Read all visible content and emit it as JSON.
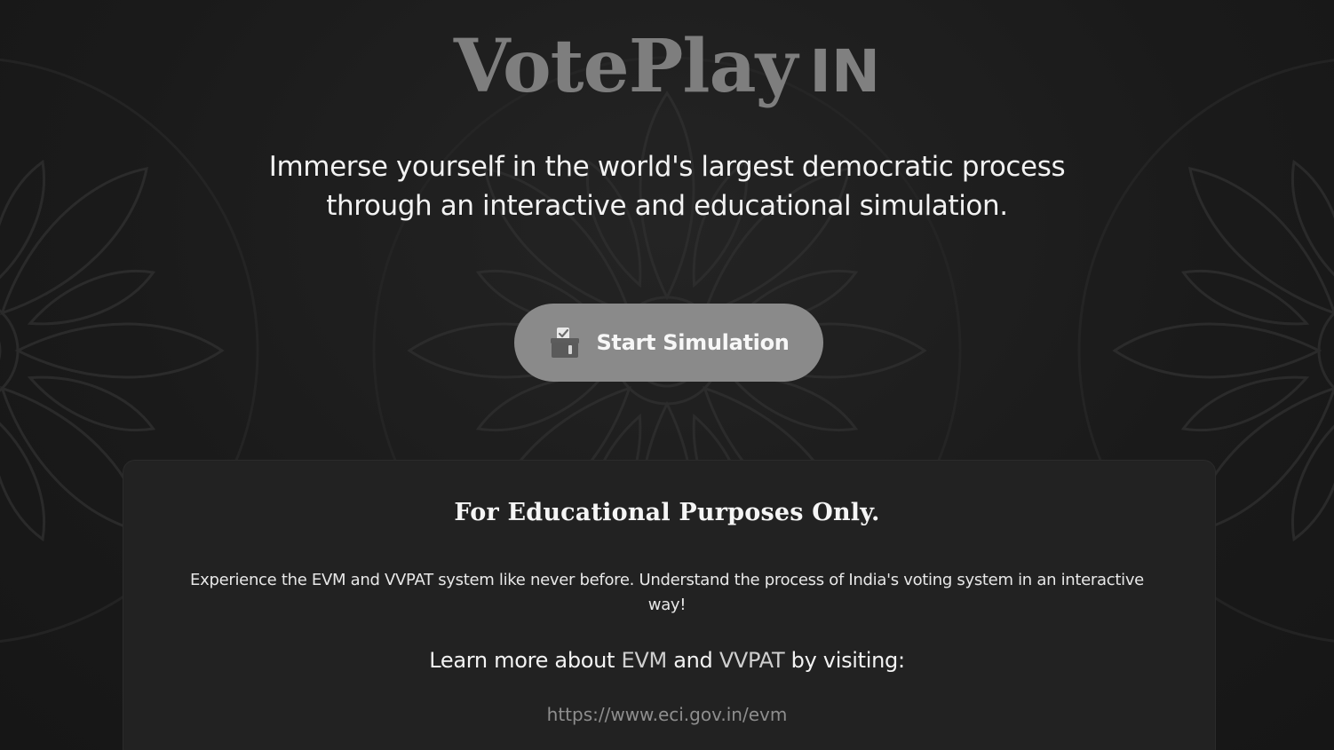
{
  "hero": {
    "brand_main": "VotePlay",
    "brand_suffix": "IN",
    "tagline_line1": "Immerse yourself in the world's largest democratic process",
    "tagline_line2": "through an interactive and educational simulation.",
    "start_button_label": "Start Simulation",
    "start_button_icon": "ballot-box-icon"
  },
  "info": {
    "title": "For Educational Purposes Only.",
    "description": "Experience the EVM and VVPAT system like never before. Understand the process of India's voting system in an interactive way!",
    "learn_prefix": "Learn more about ",
    "learn_evm": "EVM",
    "learn_and": " and ",
    "learn_vvpat": "VVPAT",
    "learn_suffix": " by visiting:",
    "link_text": "https://www.eci.gov.in/evm"
  },
  "colors": {
    "background": "#1b1b1b",
    "card": "#222222",
    "button": "#8a8a8a",
    "brand": "#7e7e7e"
  }
}
